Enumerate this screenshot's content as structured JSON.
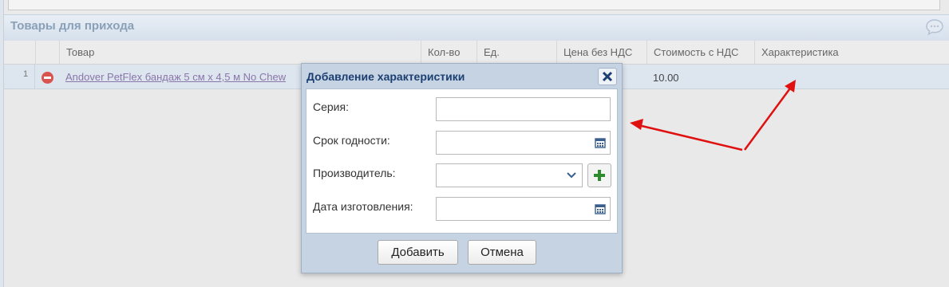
{
  "panel": {
    "title": "Товары для прихода"
  },
  "grid": {
    "columns": [
      "Товар",
      "Кол-во",
      "Ед.",
      "Цена без НДС",
      "Стоимость с НДС",
      "Характеристика"
    ],
    "rows": [
      {
        "num": "1",
        "product": "Andover PetFlex бандаж 5 см х 4,5 м No Chew",
        "cost": "10.00"
      }
    ]
  },
  "dialog": {
    "title": "Добавление характеристики",
    "fields": {
      "series_label": "Серия:",
      "expiry_label": "Срок годности:",
      "manufacturer_label": "Производитель:",
      "production_date_label": "Дата изготовления:"
    },
    "add_button": "Добавить",
    "cancel_button": "Отмена"
  },
  "icons": {
    "remove": "remove-icon",
    "close": "close-icon",
    "calendar": "calendar-icon",
    "chevron": "chevron-down-icon",
    "plus": "plus-icon",
    "chat": "chat-icon"
  },
  "colors": {
    "dialog_title": "#1c3f72",
    "remove_icon": "#d9534f",
    "plus_icon": "#2e8b2e",
    "arrow": "#e01010",
    "link": "#8a76a8"
  }
}
